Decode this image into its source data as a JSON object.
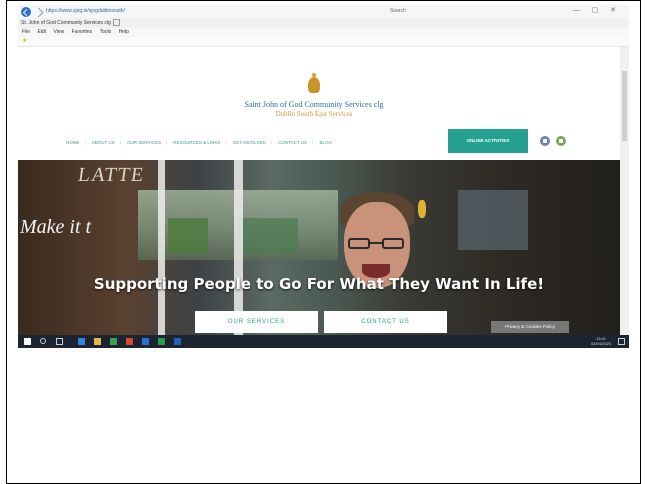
{
  "browser": {
    "url_text": "https://www.sjog.ie/sjogdublinsouth/",
    "url_host": "",
    "search_placeholder": "Search",
    "tab_title": "St. John of God Community Services clg",
    "menu_items": [
      "File",
      "Edit",
      "View",
      "Favorites",
      "Tools",
      "Help"
    ],
    "window_controls": "— ▢ ✕"
  },
  "site": {
    "org_name": "Saint John of God Community Services clg",
    "org_subtitle": "Dublin South East Services",
    "nav_items": [
      "HOME",
      "ABOUT US",
      "OUR SERVICES",
      "RESOURCES & LINKS",
      "GET INVOLVED",
      "CONTACT US",
      "BLOG"
    ],
    "online_button": "ONLINE ACTIVITIES"
  },
  "hero": {
    "sign_text": "LATTE",
    "make_text": "Make it t",
    "headline": "Supporting People to Go For What They Want In Life!",
    "button_services": "OUR SERVICES",
    "button_contact": "CONTACT US",
    "cookie_button": "Privacy & Cookies Policy"
  },
  "taskbar": {
    "time": "13:41",
    "date": "02/04/2020"
  }
}
